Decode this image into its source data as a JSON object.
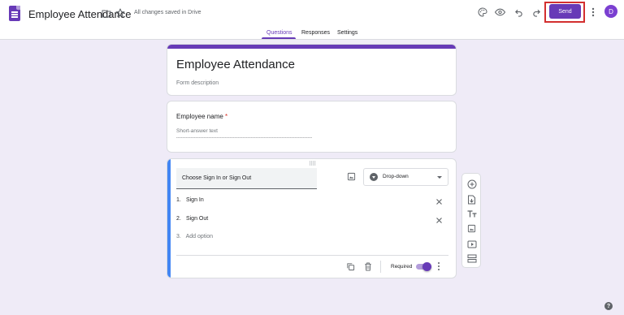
{
  "header": {
    "doc_title": "Employee Attendance",
    "save_status": "All changes saved in Drive",
    "send_label": "Send",
    "avatar_initial": "D",
    "icons": [
      "forms-logo-icon",
      "folder-icon",
      "star-icon",
      "palette-icon",
      "preview-eye-icon",
      "undo-icon",
      "redo-icon",
      "more-vert-icon"
    ]
  },
  "tabs": [
    {
      "label": "Questions",
      "active": true
    },
    {
      "label": "Responses",
      "active": false
    },
    {
      "label": "Settings",
      "active": false
    }
  ],
  "form": {
    "title": "Employee Attendance",
    "description_placeholder": "Form description"
  },
  "questions": [
    {
      "label": "Employee name",
      "required_marker": "*",
      "answer_placeholder": "Short-answer text"
    }
  ],
  "active_question": {
    "title": "Choose Sign In or Sign Out",
    "type_label": "Drop-down",
    "options": [
      {
        "number": "1.",
        "label": "Sign In"
      },
      {
        "number": "2.",
        "label": "Sign Out"
      }
    ],
    "add_option": {
      "number": "3.",
      "label": "Add option"
    },
    "required_label": "Required",
    "required_on": true
  },
  "toolbar_icons": [
    "add-question-icon",
    "import-questions-icon",
    "add-title-icon",
    "add-image-icon",
    "add-video-icon",
    "add-section-icon"
  ],
  "help_icon_glyph": "?",
  "colors": {
    "accent": "#673ab7",
    "background": "#efebf7",
    "active_question_bar": "#4285f4",
    "send_highlight": "#d32f2f",
    "required_asterisk": "#d93025"
  }
}
